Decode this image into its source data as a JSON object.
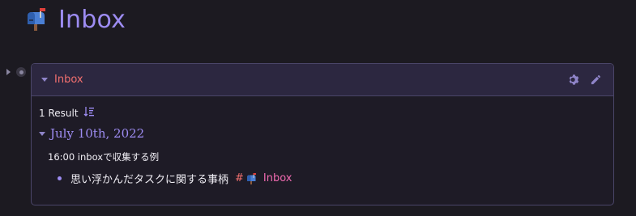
{
  "page": {
    "title": "Inbox",
    "title_icon": "mailbox-icon"
  },
  "query": {
    "title": "Inbox",
    "actions": [
      "gear-icon",
      "pencil-icon"
    ],
    "result_count": "1 Result",
    "groups": [
      {
        "date": "July 10th, 2022",
        "entry": "16:00 inboxで収集する例",
        "child": {
          "text": "思い浮かんだタスクに関する事柄",
          "tag_hash": "#",
          "tag_icon": "mailbox-icon",
          "tag_label": "Inbox"
        }
      }
    ]
  },
  "colors": {
    "background": "#1c1a21",
    "accent_purple": "#9d8cf2",
    "title_red": "#f3706f",
    "tag_pink": "#f06ab0"
  }
}
